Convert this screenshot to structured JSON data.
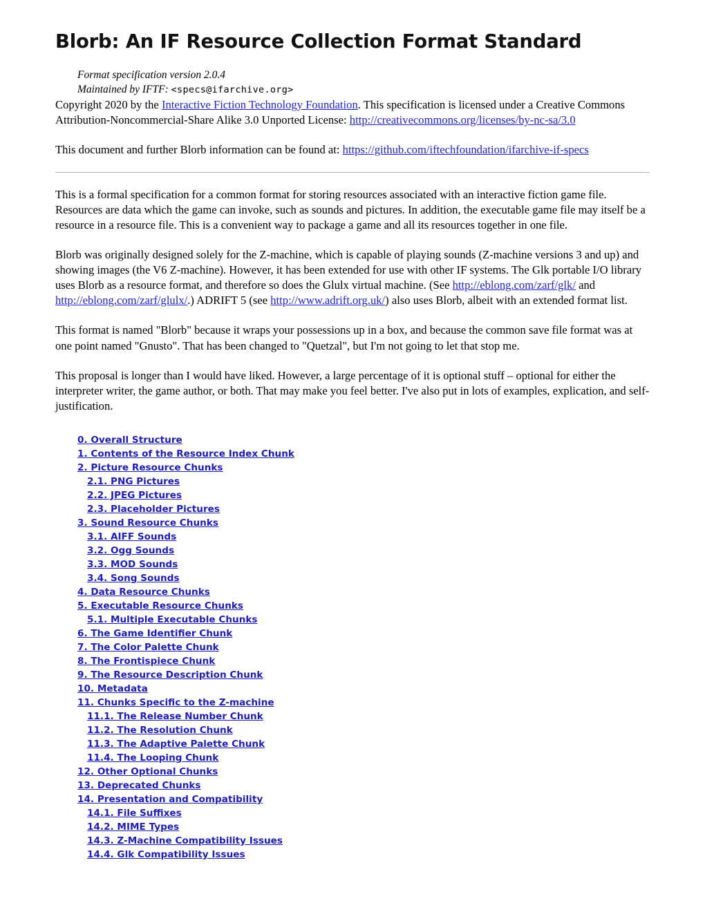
{
  "document": {
    "title": "Blorb: An IF Resource Collection Format Standard",
    "version_line": "Format specification version 2.0.4",
    "maintainer_label": "Maintained by IFTF:",
    "maintainer_email": "<specs@ifarchive.org>",
    "copyright": {
      "prefix": "Copyright 2020 by the ",
      "org_link": "Interactive Fiction Technology Foundation",
      "middle": ". This specification is licensed under a Creative Commons Attribution-Noncommercial-Share Alike 3.0 Unported License: ",
      "license_link": "http://creativecommons.org/licenses/by-nc-sa/3.0"
    },
    "found_at": {
      "prefix": "This document and further Blorb information can be found at:  ",
      "link": "https://github.com/iftechfoundation/ifarchive-if-specs"
    },
    "paragraphs": {
      "p1": "This is a formal specification for a common format for storing resources associated with an interactive fiction game file. Resources are data which the game can invoke, such as sounds and pictures. In addition, the executable game file may itself be a resource in a resource file. This is a convenient way to package a game and all its resources together in one file.",
      "p2_a": "Blorb was originally designed solely for the Z-machine, which is capable of playing sounds (Z-machine versions 3 and up) and showing images (the V6 Z-machine). However, it has been extended for use with other IF systems. The Glk portable I/O library uses Blorb as a resource format, and therefore so does the Glulx virtual machine. (See ",
      "p2_link1": "http://eblong.com/zarf/glk/",
      "p2_b": " and ",
      "p2_link2": "http://eblong.com/zarf/glulx/",
      "p2_c": ".) ADRIFT 5 (see ",
      "p2_link3": "http://www.adrift.org.uk/",
      "p2_d": ") also uses Blorb, albeit with an extended format list.",
      "p3": "This format is named \"Blorb\" because it wraps your possessions up in a box, and because the common save file format was at one point named \"Gnusto\". That has been changed to \"Quetzal\", but I'm not going to let that stop me.",
      "p4": "This proposal is longer than I would have liked. However, a large percentage of it is optional stuff – optional for either the interpreter writer, the game author, or both. That may make you feel better. I've also put in lots of examples, explication, and self-justification."
    },
    "colors": {
      "inline_link": "#2323cc",
      "toc_link": "#1e1eb4",
      "rule": "#b4b4b4",
      "text": "#000000",
      "background": "#ffffff"
    }
  },
  "toc": [
    {
      "label": "0. Overall Structure",
      "level": 1
    },
    {
      "label": "1. Contents of the Resource Index Chunk",
      "level": 1
    },
    {
      "label": "2. Picture Resource Chunks",
      "level": 1
    },
    {
      "label": "2.1. PNG Pictures",
      "level": 2
    },
    {
      "label": "2.2. JPEG Pictures",
      "level": 2
    },
    {
      "label": "2.3. Placeholder Pictures",
      "level": 2
    },
    {
      "label": "3. Sound Resource Chunks",
      "level": 1
    },
    {
      "label": "3.1. AIFF Sounds",
      "level": 2
    },
    {
      "label": "3.2. Ogg Sounds",
      "level": 2
    },
    {
      "label": "3.3. MOD Sounds",
      "level": 2
    },
    {
      "label": "3.4. Song Sounds",
      "level": 2
    },
    {
      "label": "4. Data Resource Chunks",
      "level": 1
    },
    {
      "label": "5. Executable Resource Chunks",
      "level": 1
    },
    {
      "label": "5.1. Multiple Executable Chunks",
      "level": 2
    },
    {
      "label": "6. The Game Identifier Chunk",
      "level": 1
    },
    {
      "label": "7. The Color Palette Chunk",
      "level": 1
    },
    {
      "label": "8. The Frontispiece Chunk",
      "level": 1
    },
    {
      "label": "9. The Resource Description Chunk",
      "level": 1
    },
    {
      "label": "10. Metadata",
      "level": 1
    },
    {
      "label": "11. Chunks Specific to the Z-machine",
      "level": 1
    },
    {
      "label": "11.1. The Release Number Chunk",
      "level": 2
    },
    {
      "label": "11.2. The Resolution Chunk",
      "level": 2
    },
    {
      "label": "11.3. The Adaptive Palette Chunk",
      "level": 2
    },
    {
      "label": "11.4. The Looping Chunk",
      "level": 2
    },
    {
      "label": "12. Other Optional Chunks",
      "level": 1
    },
    {
      "label": "13. Deprecated Chunks",
      "level": 1
    },
    {
      "label": "14. Presentation and Compatibility",
      "level": 1
    },
    {
      "label": "14.1. File Suffixes",
      "level": 2
    },
    {
      "label": "14.2. MIME Types",
      "level": 2
    },
    {
      "label": "14.3. Z-Machine Compatibility Issues",
      "level": 2
    },
    {
      "label": "14.4. Glk Compatibility Issues",
      "level": 2
    }
  ]
}
